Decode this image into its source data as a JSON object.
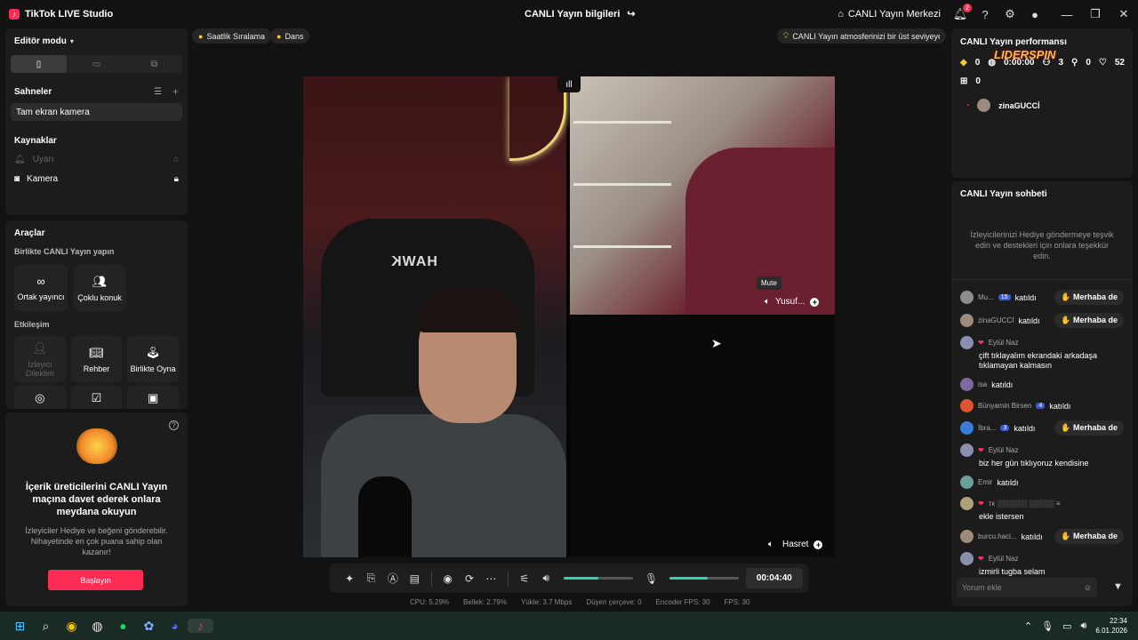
{
  "app": {
    "title": "TikTok LIVE Studio",
    "center_title": "CANLI Yayın bilgileri",
    "center_link": "CANLI Yayın Merkezi",
    "notif_count": "2"
  },
  "left": {
    "editor_mode": "Editör modu",
    "scenes_title": "Sahneler",
    "scene_item": "Tam ekran kamera",
    "sources_title": "Kaynaklar",
    "sources": [
      "Uyarı",
      "Kamera"
    ],
    "tools_title": "Araçlar",
    "collab_title": "Birlikte CANLI Yayın yapın",
    "collab_tools": [
      "Ortak yayıncı",
      "Çoklu konuk"
    ],
    "interaction_title": "Etkileşim",
    "interaction_tools": [
      "İzleyici Dilekleri",
      "Rehber",
      "Birlikte Oyna"
    ],
    "promo_title": "İçerik üreticilerini CANLI Yayın maçına davet ederek onlara meydana okuyun",
    "promo_text": "İzleyiciler Hediye ve beğeni gönderebilir. Nihayetinde en çok puana sahip olan kazanır!",
    "promo_button": "Başlayın"
  },
  "chips": {
    "hourly": "Saatlik Sıralama",
    "dance": "Dans",
    "tip": "CANLI Yayın atmosferinizi bir üst seviyeye ..."
  },
  "video": {
    "chair_brand": "HAWK",
    "guest_top": "Yusuf...",
    "guest_bottom": "Hasret",
    "mute_tip": "Mute"
  },
  "controls": {
    "timer": "00:04:40",
    "volume": 0.5,
    "mic": 0.55
  },
  "stats": [
    "CPU: 5.29%",
    "Bellek: 2.79%",
    "Yükle: 3.7 Mbps",
    "Düşen çerçeve: 0",
    "Encoder FPS: 30",
    "FPS: 30"
  ],
  "performance": {
    "title": "CANLI Yayın performansı",
    "coins": "0",
    "diamonds": "0:00:00",
    "viewers": "3",
    "new": "0",
    "likes": "52",
    "gifts": "0",
    "top_user": "zinaGUCCİ",
    "watermark": "LIDERSPIN"
  },
  "chat": {
    "title": "CANLI Yayın sohbeti",
    "hint": "İzleyicilerinizi Hediye göndermeye teşvik edin ve destekleri için onlara teşekkür edin.",
    "wave_label": "Merhaba de",
    "joined": "katıldı",
    "messages": [
      {
        "name": "Mu...",
        "level": "15",
        "text": "",
        "joined": true,
        "wave": true
      },
      {
        "name": "zinaGUCCİ",
        "level": "",
        "text": "",
        "joined": true,
        "wave": true
      },
      {
        "name": "Eylül Naz",
        "level": "",
        "text": "çift tıklayalım ekrandaki arkadaşa tıklamayan kalmasın",
        "joined": false,
        "wave": false
      },
      {
        "name": "isa",
        "level": "",
        "text": "",
        "joined": true,
        "wave": false
      },
      {
        "name": "Bünyamin Birsen",
        "level": "4",
        "text": "",
        "joined": true,
        "wave": false
      },
      {
        "name": "İbra...",
        "level": "3",
        "text": "",
        "joined": true,
        "wave": true
      },
      {
        "name": "Eylül Naz",
        "level": "",
        "text": "biz her gün tıklıyoruz kendisine",
        "joined": false,
        "wave": false
      },
      {
        "name": "Emir",
        "level": "",
        "text": "",
        "joined": true,
        "wave": false
      },
      {
        "name": "тк ░░░░░░ ░░░░░ ≡",
        "level": "",
        "text": "ekle istersen",
        "joined": false,
        "wave": false
      },
      {
        "name": "burcu.haci...",
        "level": "",
        "text": "",
        "joined": true,
        "wave": true
      },
      {
        "name": "Eylül Naz",
        "level": "",
        "text": "izmirli tugba selam",
        "joined": false,
        "wave": false
      }
    ],
    "comment_placeholder": "Yorum ekle"
  },
  "taskbar": {
    "time": "22:34",
    "date": "6.01.2026"
  }
}
